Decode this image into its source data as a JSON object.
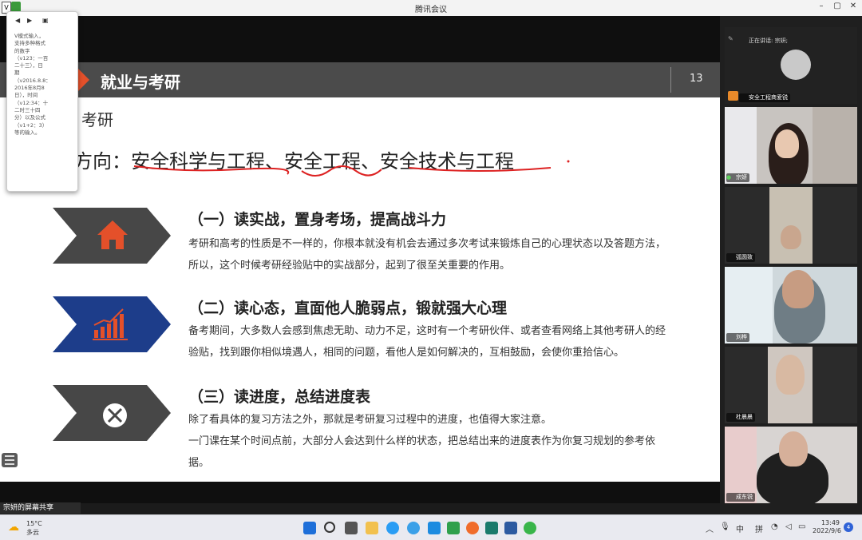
{
  "window": {
    "title": "腾讯会议",
    "minimize": "–",
    "maximize": "▢",
    "close": "✕"
  },
  "slide": {
    "header_title": "就业与考研",
    "page_number": "13",
    "subtitle": "考研",
    "direction_label": "方向：",
    "direction_items": [
      "安全科学与工程",
      "、",
      "安全工程",
      "、",
      "安全技术与工程"
    ],
    "items": [
      {
        "heading": "（一）读实战，置身考场，提高战斗力",
        "body": "考研和高考的性质是不一样的，你根本就没有机会去通过多次考试来锻炼自己的心理状态以及答题方法，所以，这个时候考研经验贴中的实战部分，起到了很至关重要的作用。",
        "icon": "house-icon"
      },
      {
        "heading": "（二）读心态，直面他人脆弱点，锻就强大心理",
        "body": "备考期间，大多数人会感到焦虑无助、动力不足，这时有一个考研伙伴、或者查看网络上其他考研人的经验贴，找到跟你相似境遇人，相同的问题，看他人是如何解决的，互相鼓励，会使你重拾信心。",
        "icon": "growth-chart-icon"
      },
      {
        "heading": "（三）读进度，总结进度表",
        "body_lines": [
          "除了看具体的复习方法之外，那就是考研复习过程中的进度，也值得大家注意。",
          "一门课在某个时间点前，大部分人会达到什么样的状态，把总结出来的进度表作为你复习规划的参考依据。"
        ],
        "icon": "tools-icon"
      }
    ]
  },
  "popup": {
    "lines": [
      "V模式输入，",
      "支持多种格式",
      "的数字",
      "（v123：一百",
      "二十三），日",
      "期",
      "（v2016.8.8：",
      "2016年8月8",
      "日），时间",
      "（v12:34：十",
      "二时三十四",
      "分）以及公式",
      "（v1+2：3）",
      "等的输入。"
    ]
  },
  "share_label": "宗妍的屏幕共享",
  "participants": {
    "speaking_text": "正在讲话: 宗妍;",
    "names": [
      "安全工程商爱锐",
      "宗妍",
      "弧圆致",
      "刘桦",
      "杜晨晨",
      "成东锐"
    ]
  },
  "taskbar": {
    "temperature": "15°C",
    "weather": "多云",
    "ime": "中",
    "pinyin": "拼",
    "time": "13:49",
    "date": "2022/9/6",
    "notifications": "4"
  }
}
